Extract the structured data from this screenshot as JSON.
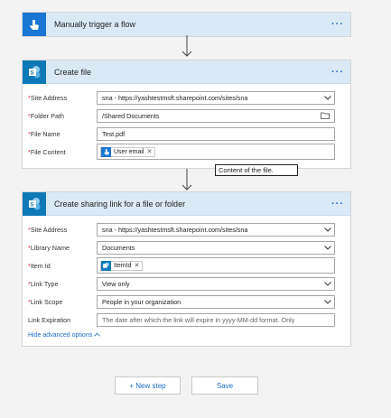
{
  "trigger": {
    "title": "Manually trigger a flow",
    "menu": "···"
  },
  "create_file": {
    "title": "Create file",
    "menu": "···",
    "fields": {
      "site_address": {
        "label": "Site Address",
        "value": "sna - https://yashtestmsft.sharepoint.com/sites/sna"
      },
      "folder_path": {
        "label": "Folder Path",
        "value": "/Shared Documents"
      },
      "file_name": {
        "label": "File Name",
        "value": "Test.pdf"
      },
      "file_content": {
        "label": "File Content",
        "token": "User email"
      }
    },
    "required_mark": "*"
  },
  "tooltip": "Content of the file.",
  "sharing_link": {
    "title": "Create sharing link for a file or folder",
    "menu": "···",
    "fields": {
      "site_address": {
        "label": "Site Address",
        "value": "sna - https://yashtestmsft.sharepoint.com/sites/sna"
      },
      "library_name": {
        "label": "Library Name",
        "value": "Documents"
      },
      "item_id": {
        "label": "Item Id",
        "token": "ItemId"
      },
      "link_type": {
        "label": "Link Type",
        "value": "View only"
      },
      "link_scope": {
        "label": "Link Scope",
        "value": "People in your organization"
      },
      "link_expiration": {
        "label": "Link Expiration",
        "placeholder": "The date after which the link will expire in yyyy-MM-dd format. Only"
      }
    },
    "advanced_toggle": "Hide advanced options"
  },
  "footer": {
    "new_step": "+ New step",
    "save": "Save"
  },
  "colors": {
    "accent": "#1b6ac9",
    "header_bg": "#dbe9f7",
    "sharepoint": "#0f78b6",
    "required": "#d13438"
  }
}
